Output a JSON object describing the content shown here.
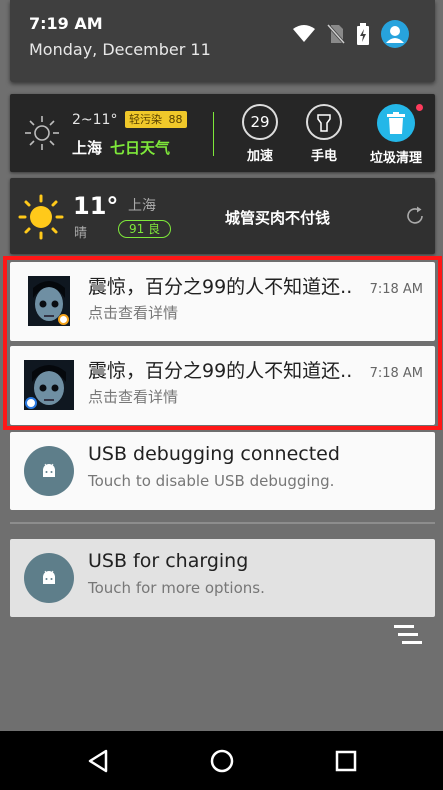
{
  "status": {
    "time": "7:19 AM",
    "date": "Monday, December 11"
  },
  "tools_widget": {
    "temp_range": "2~11°",
    "pollution_badge": "轻污染",
    "aqi": "88",
    "city": "上海",
    "forecast_link": "七日天气",
    "boost_value": "29",
    "boost_label": "加速",
    "flashlight_label": "手电",
    "cleanup_label": "垃圾清理"
  },
  "weather_widget": {
    "temperature": "11°",
    "city": "上海",
    "condition": "晴",
    "air_quality": "91 良",
    "headline": "城管买肉不付钱"
  },
  "notifications": [
    {
      "title": "震惊，百分之99的人不知道还..",
      "subtitle": "点击查看详情",
      "time": "7:18 AM"
    },
    {
      "title": "震惊，百分之99的人不知道还..",
      "subtitle": "点击查看详情",
      "time": "7:18 AM"
    }
  ],
  "usb_debug": {
    "title": "USB debugging connected",
    "subtitle": "Touch to disable USB debugging."
  },
  "usb_charging": {
    "title": "USB for charging",
    "subtitle": "Touch for more options."
  },
  "colors": {
    "accent_green": "#7ee83a",
    "badge_yellow": "#f0c82a",
    "highlight_red": "#ff1717",
    "cleanup_blue": "#24b7e8"
  }
}
